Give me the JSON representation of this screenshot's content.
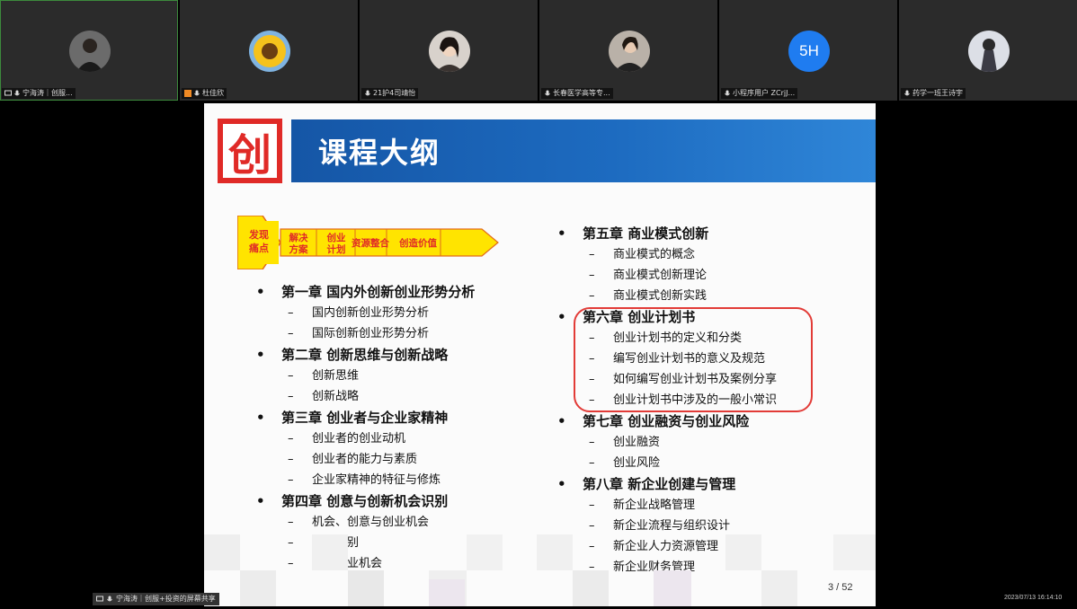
{
  "participants": [
    {
      "name": "宁海涛｜创服...",
      "avatar": "person-avatar",
      "active": true
    },
    {
      "name": "杜佳欣",
      "avatar": "sunflower-avatar",
      "active": false
    },
    {
      "name": "21护4司靖怡",
      "avatar": "person-avatar",
      "active": false
    },
    {
      "name": "长春医学高等专...",
      "avatar": "person-avatar",
      "active": false
    },
    {
      "name": "小程序用户 ZCrjJ...",
      "avatar_initials": "5H",
      "active": false
    },
    {
      "name": "药学一班王诗宇",
      "avatar": "person-avatar",
      "active": false
    }
  ],
  "slide": {
    "logo_char": "创",
    "title": "课程大纲",
    "flow": [
      {
        "line1": "发现",
        "line2": "痛点"
      },
      {
        "line1": "解决",
        "line2": "方案"
      },
      {
        "line1": "创业",
        "line2": "计划"
      },
      {
        "line1": "资源整合",
        "line2": ""
      },
      {
        "line1": "创造价值",
        "line2": ""
      }
    ],
    "left_chapters": [
      {
        "title": "第一章 国内外创新创业形势分析",
        "items": [
          "国内创新创业形势分析",
          "国际创新创业形势分析"
        ]
      },
      {
        "title": "第二章 创新思维与创新战略",
        "items": [
          "创新思维",
          "创新战略"
        ]
      },
      {
        "title": "第三章 创业者与企业家精神",
        "items": [
          "创业者的创业动机",
          "创业者的能力与素质",
          "企业家精神的特征与修炼"
        ]
      },
      {
        "title": "第四章 创意与创新机会识别",
        "items": [
          "机会、创意与创业机会",
          "机会识别",
          "评价创业机会"
        ]
      }
    ],
    "right_chapters": [
      {
        "title": "第五章 商业模式创新",
        "items": [
          "商业模式的概念",
          "商业模式创新理论",
          "商业模式创新实践"
        ]
      },
      {
        "title": "第六章 创业计划书",
        "items": [
          "创业计划书的定义和分类",
          "编写创业计划书的意义及规范",
          "如何编写创业计划书及案例分享",
          "创业计划书中涉及的一般小常识"
        ]
      },
      {
        "title": "第七章 创业融资与创业风险",
        "items": [
          "创业融资",
          "创业风险"
        ]
      },
      {
        "title": "第八章 新企业创建与管理",
        "items": [
          "新企业战略管理",
          "新企业流程与组织设计",
          "新企业人力资源管理",
          "新企业财务管理"
        ]
      }
    ],
    "bullet": "•",
    "dash": "–",
    "page_indicator": "3 / 52"
  },
  "footer": {
    "share_label": "宁海涛｜创服+投资的屏幕共享",
    "timestamp": "2023/07/13 16:14:10"
  },
  "colors": {
    "brand_red": "#e02a27",
    "title_blue": "#1d6bc0",
    "flow_yellow": "#ffe400",
    "highlight_red": "#e23b37",
    "avatar_blue": "#1f7cf0"
  }
}
